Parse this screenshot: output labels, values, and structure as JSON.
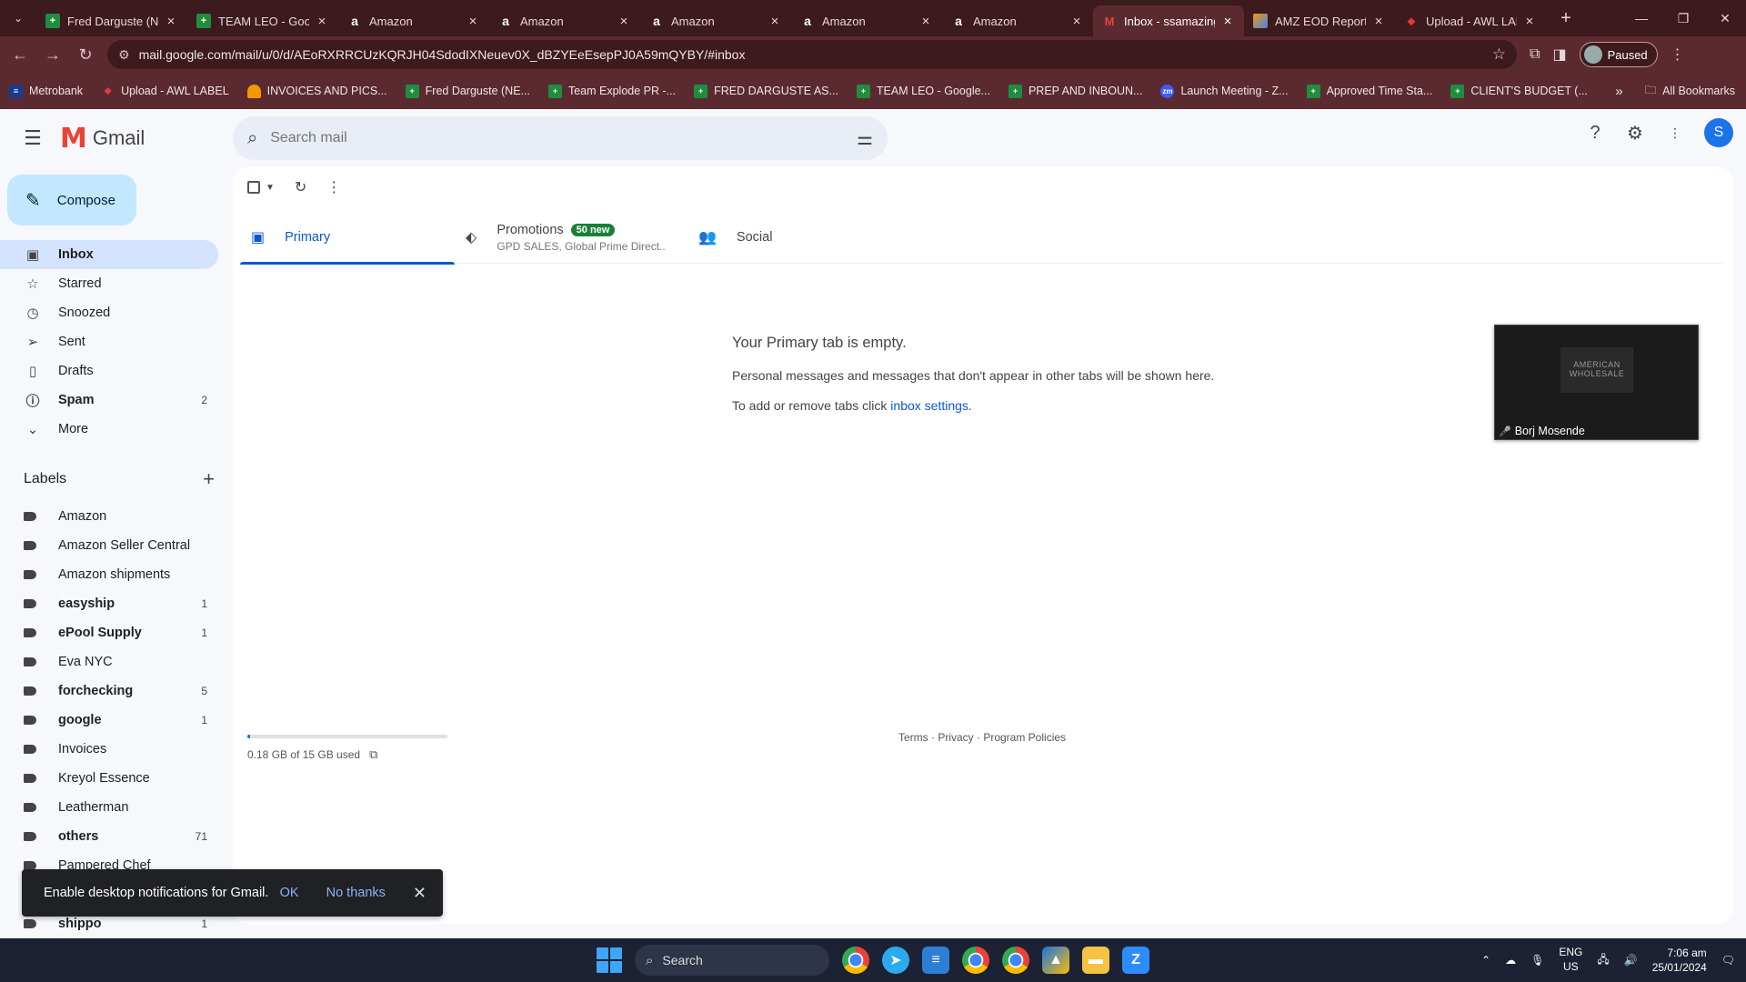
{
  "browser": {
    "tabs": [
      {
        "title": "Fred Darguste (NE...",
        "icon": "sheets"
      },
      {
        "title": "TEAM LEO - Google...",
        "icon": "sheets"
      },
      {
        "title": "Amazon",
        "icon": "amazon"
      },
      {
        "title": "Amazon",
        "icon": "amazon"
      },
      {
        "title": "Amazon",
        "icon": "amazon"
      },
      {
        "title": "Amazon",
        "icon": "amazon"
      },
      {
        "title": "Amazon",
        "icon": "amazon"
      },
      {
        "title": "Inbox - ssamazing...",
        "icon": "gmail",
        "active": true
      },
      {
        "title": "AMZ EOD Report",
        "icon": "amz"
      },
      {
        "title": "Upload - AWL LAB...",
        "icon": "pdf"
      }
    ],
    "url": "mail.google.com/mail/u/0/d/AEoRXRRCUzKQRJH04SdodIXNeuev0X_dBZYEeEsepPJ0A59mQYBY/#inbox",
    "profile_status": "Paused",
    "bookmarks": [
      {
        "label": "Metrobank",
        "icon": "mb"
      },
      {
        "label": "Upload - AWL LABEL",
        "icon": "pdf"
      },
      {
        "label": "INVOICES AND PICS...",
        "icon": "inv"
      },
      {
        "label": "Fred Darguste (NE...",
        "icon": "sheets"
      },
      {
        "label": "Team Explode PR -...",
        "icon": "sheets"
      },
      {
        "label": "FRED DARGUSTE AS...",
        "icon": "sheets"
      },
      {
        "label": "TEAM LEO - Google...",
        "icon": "sheets"
      },
      {
        "label": "PREP AND INBOUN...",
        "icon": "sheets"
      },
      {
        "label": "Launch Meeting - Z...",
        "icon": "zm"
      },
      {
        "label": "Approved Time Sta...",
        "icon": "sheets"
      },
      {
        "label": "CLIENT'S BUDGET (...",
        "icon": "sheets"
      }
    ],
    "all_bookmarks": "All Bookmarks"
  },
  "gmail": {
    "app_name": "Gmail",
    "search_placeholder": "Search mail",
    "avatar_letter": "S",
    "compose_label": "Compose",
    "nav": [
      {
        "label": "Inbox",
        "icon": "▣",
        "active": true,
        "bold": true,
        "count": ""
      },
      {
        "label": "Starred",
        "icon": "☆",
        "count": ""
      },
      {
        "label": "Snoozed",
        "icon": "◷",
        "count": ""
      },
      {
        "label": "Sent",
        "icon": "➢",
        "count": ""
      },
      {
        "label": "Drafts",
        "icon": "▯",
        "count": ""
      },
      {
        "label": "Spam",
        "icon": "ⓘ",
        "bold": true,
        "count": "2"
      },
      {
        "label": "More",
        "icon": "⌄",
        "count": ""
      }
    ],
    "labels_heading": "Labels",
    "labels": [
      {
        "name": "Amazon",
        "count": "",
        "bold": false
      },
      {
        "name": "Amazon Seller Central",
        "count": "",
        "bold": false
      },
      {
        "name": "Amazon shipments",
        "count": "",
        "bold": false
      },
      {
        "name": "easyship",
        "count": "1",
        "bold": true
      },
      {
        "name": "ePool Supply",
        "count": "1",
        "bold": true
      },
      {
        "name": "Eva NYC",
        "count": "",
        "bold": false
      },
      {
        "name": "forchecking",
        "count": "5",
        "bold": true
      },
      {
        "name": "google",
        "count": "1",
        "bold": true
      },
      {
        "name": "Invoices",
        "count": "",
        "bold": false
      },
      {
        "name": "Kreyol Essence",
        "count": "",
        "bold": false
      },
      {
        "name": "Leatherman",
        "count": "",
        "bold": false
      },
      {
        "name": "others",
        "count": "71",
        "bold": true
      },
      {
        "name": "Pampered Chef",
        "count": "",
        "bold": false
      },
      {
        "name": "",
        "count": "",
        "bold": false
      },
      {
        "name": "shippo",
        "count": "1",
        "bold": true
      }
    ],
    "tabs": {
      "primary": "Primary",
      "promotions": "Promotions",
      "promotions_badge": "50 new",
      "promotions_sub": "GPD SALES, Global Prime Direct...",
      "social": "Social"
    },
    "empty": {
      "title": "Your Primary tab is empty.",
      "line1": "Personal messages and messages that don't appear in other tabs will be shown here.",
      "line2_prefix": "To add or remove tabs click ",
      "line2_link": "inbox settings",
      "line2_suffix": "."
    },
    "storage": {
      "text": "0.18 GB of 15 GB used",
      "fraction": 0.012
    },
    "footer": "Terms · Privacy · Program Policies",
    "snackbar": {
      "message": "Enable desktop notifications for Gmail.",
      "ok": "OK",
      "no": "No thanks"
    }
  },
  "video_thumb": {
    "name": "Borj Mosende",
    "logo_text": "AMERICAN WHOLESALE"
  },
  "taskbar": {
    "search": "Search",
    "lang": "ENG",
    "region": "US",
    "time": "7:06 am",
    "date": "25/01/2024"
  }
}
